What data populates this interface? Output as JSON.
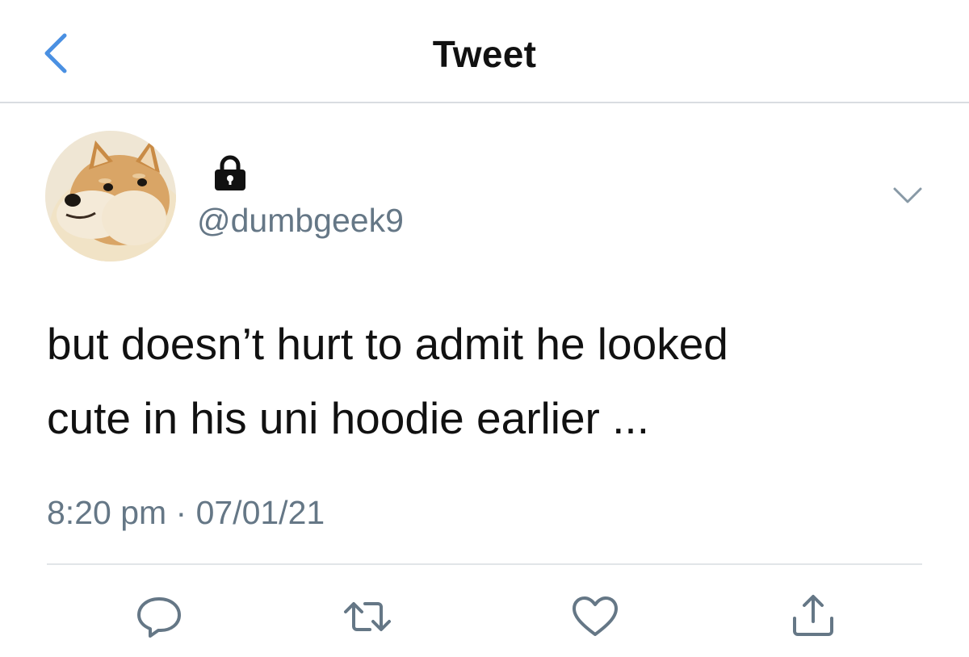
{
  "nav": {
    "back_icon": "chevron-left-icon",
    "title": "Tweet",
    "accent_color": "#4a90e2"
  },
  "tweet": {
    "avatar": "doge-avatar",
    "protected_icon": "lock-icon",
    "handle": "@dumbgeek9",
    "menu_icon": "chevron-down-icon",
    "text": "but doesn’t hurt to admit he looked\ncute in his uni hoodie earlier ...",
    "timestamp": "8:20 pm · 07/01/21"
  },
  "actions": [
    {
      "name": "reply",
      "icon": "reply-bubble-icon"
    },
    {
      "name": "retweet",
      "icon": "retweet-icon"
    },
    {
      "name": "like",
      "icon": "heart-icon"
    },
    {
      "name": "share",
      "icon": "share-icon"
    }
  ],
  "colors": {
    "text_primary": "#111111",
    "text_secondary": "#657786",
    "icon_gray": "#657786",
    "divider": "#e1e5e8"
  }
}
